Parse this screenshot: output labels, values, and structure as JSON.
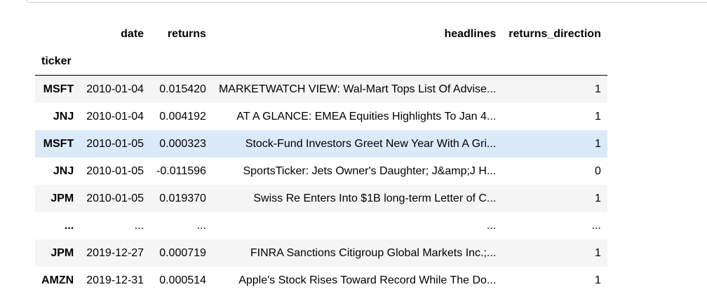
{
  "columns": {
    "date": "date",
    "returns": "returns",
    "headlines": "headlines",
    "returns_direction": "returns_direction"
  },
  "index_name": "ticker",
  "rows": [
    {
      "ticker": "MSFT",
      "date": "2010-01-04",
      "returns": "0.015420",
      "headlines": "MARKETWATCH VIEW: Wal-Mart Tops List Of Advise...",
      "returns_direction": "1"
    },
    {
      "ticker": "JNJ",
      "date": "2010-01-04",
      "returns": "0.004192",
      "headlines": "AT A GLANCE: EMEA Equities Highlights To Jan 4...",
      "returns_direction": "1"
    },
    {
      "ticker": "MSFT",
      "date": "2010-01-05",
      "returns": "0.000323",
      "headlines": "Stock-Fund Investors Greet New Year With A Gri...",
      "returns_direction": "1"
    },
    {
      "ticker": "JNJ",
      "date": "2010-01-05",
      "returns": "-0.011596",
      "headlines": "SportsTicker: Jets Owner's Daughter; J&amp;J H...",
      "returns_direction": "0"
    },
    {
      "ticker": "JPM",
      "date": "2010-01-05",
      "returns": "0.019370",
      "headlines": "Swiss Re Enters Into $1B long-term Letter of C...",
      "returns_direction": "1"
    },
    {
      "ticker": "...",
      "date": "...",
      "returns": "...",
      "headlines": "...",
      "returns_direction": "..."
    },
    {
      "ticker": "JPM",
      "date": "2019-12-27",
      "returns": "0.000719",
      "headlines": "FINRA Sanctions Citigroup Global Markets Inc.;...",
      "returns_direction": "1"
    },
    {
      "ticker": "AMZN",
      "date": "2019-12-31",
      "returns": "0.000514",
      "headlines": "Apple's Stock Rises Toward Record While The Do...",
      "returns_direction": "1"
    }
  ],
  "colors": {
    "row_stripe": "#f5f5f5",
    "row_hover": "#dbeaf8",
    "header_rule": "#000000"
  }
}
